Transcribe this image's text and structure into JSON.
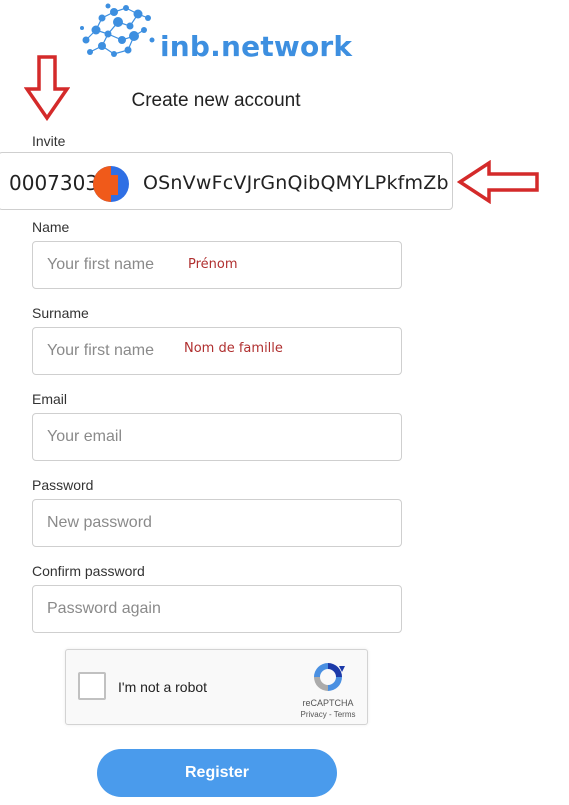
{
  "logo": {
    "text": "inb.network",
    "color": "#3d8fe0"
  },
  "page_title": "Create new account",
  "invite": {
    "label": "Invite",
    "number": "0007303",
    "code": "OSnVwFcVJrGnQibQMYLPkfmZb",
    "avatar_colors": [
      "#2f6fe4",
      "#f05a1a"
    ]
  },
  "fields": [
    {
      "label": "Name",
      "placeholder": "Your first name",
      "annotation": "Prénom"
    },
    {
      "label": "Surname",
      "placeholder": "Your first name",
      "annotation": "Nom de famille"
    },
    {
      "label": "Email",
      "placeholder": "Your email"
    },
    {
      "label": "Password",
      "placeholder": "New password"
    },
    {
      "label": "Confirm password",
      "placeholder": "Password again"
    }
  ],
  "captcha": {
    "label": "I'm not a robot",
    "brand": "reCAPTCHA",
    "links": "Privacy - Terms"
  },
  "register_label": "Register",
  "annotation_arrows": {
    "color": "#d42a2a"
  },
  "accent_color": "#4a9bec"
}
